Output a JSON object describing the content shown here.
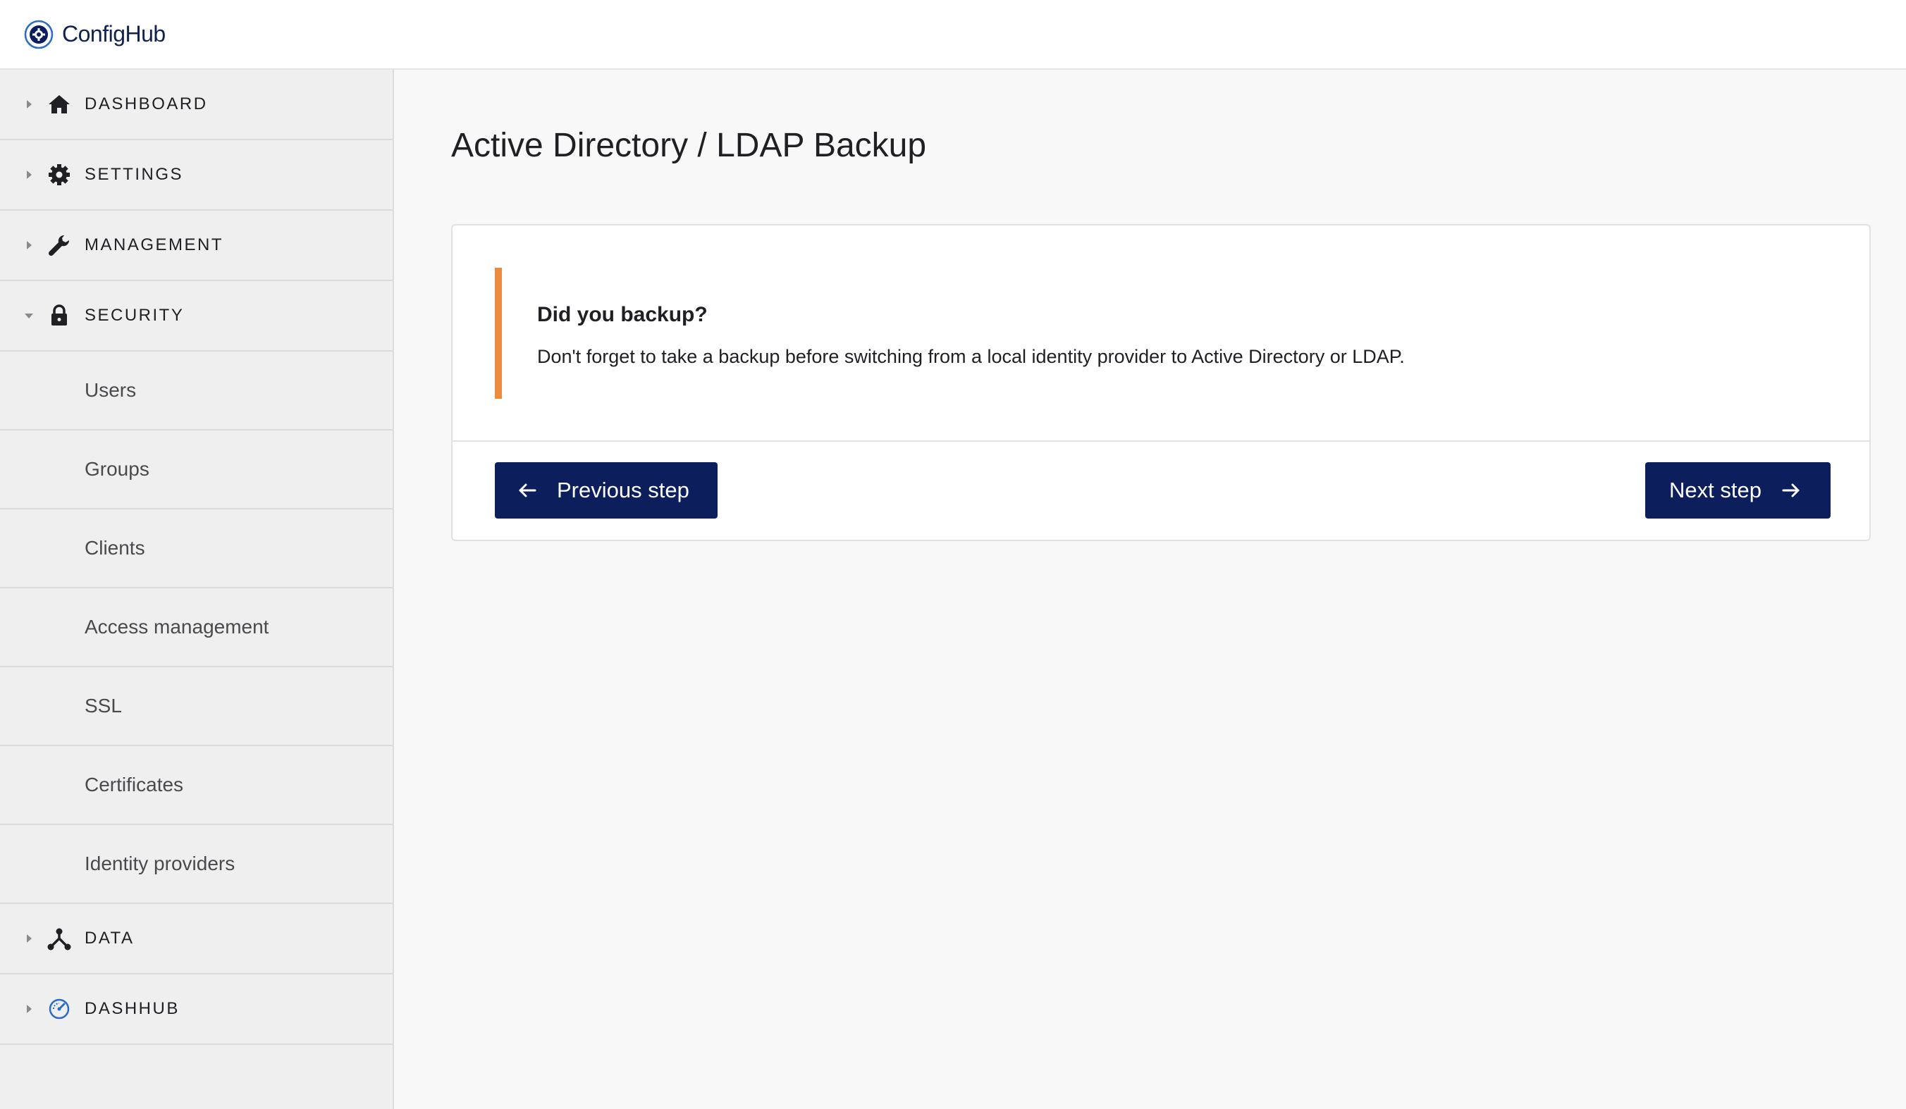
{
  "app": {
    "logo_config": "Config",
    "logo_hub": "Hub"
  },
  "sidebar": {
    "sections": [
      {
        "label": "DASHBOARD",
        "icon": "home-icon",
        "expanded": false
      },
      {
        "label": "SETTINGS",
        "icon": "gear-icon",
        "expanded": false
      },
      {
        "label": "MANAGEMENT",
        "icon": "wrench-icon",
        "expanded": false
      },
      {
        "label": "SECURITY",
        "icon": "lock-icon",
        "expanded": true
      }
    ],
    "security_items": [
      "Users",
      "Groups",
      "Clients",
      "Access management",
      "SSL",
      "Certificates",
      "Identity providers"
    ],
    "sections_after": [
      {
        "label": "DATA",
        "icon": "data-fork-icon",
        "expanded": false
      },
      {
        "label": "DASHHUB",
        "icon": "dashhub-icon",
        "expanded": false
      }
    ]
  },
  "main": {
    "title": "Active Directory / LDAP Backup",
    "notice": {
      "title": "Did you backup?",
      "body": "Don't forget to take a backup before switching from a local identity provider to Active Directory or LDAP.",
      "accent_color": "#ee8a3c"
    },
    "buttons": {
      "previous": "Previous step",
      "next": "Next step"
    }
  },
  "colors": {
    "brand": "#0c1f5c",
    "accent": "#ee8a3c"
  }
}
